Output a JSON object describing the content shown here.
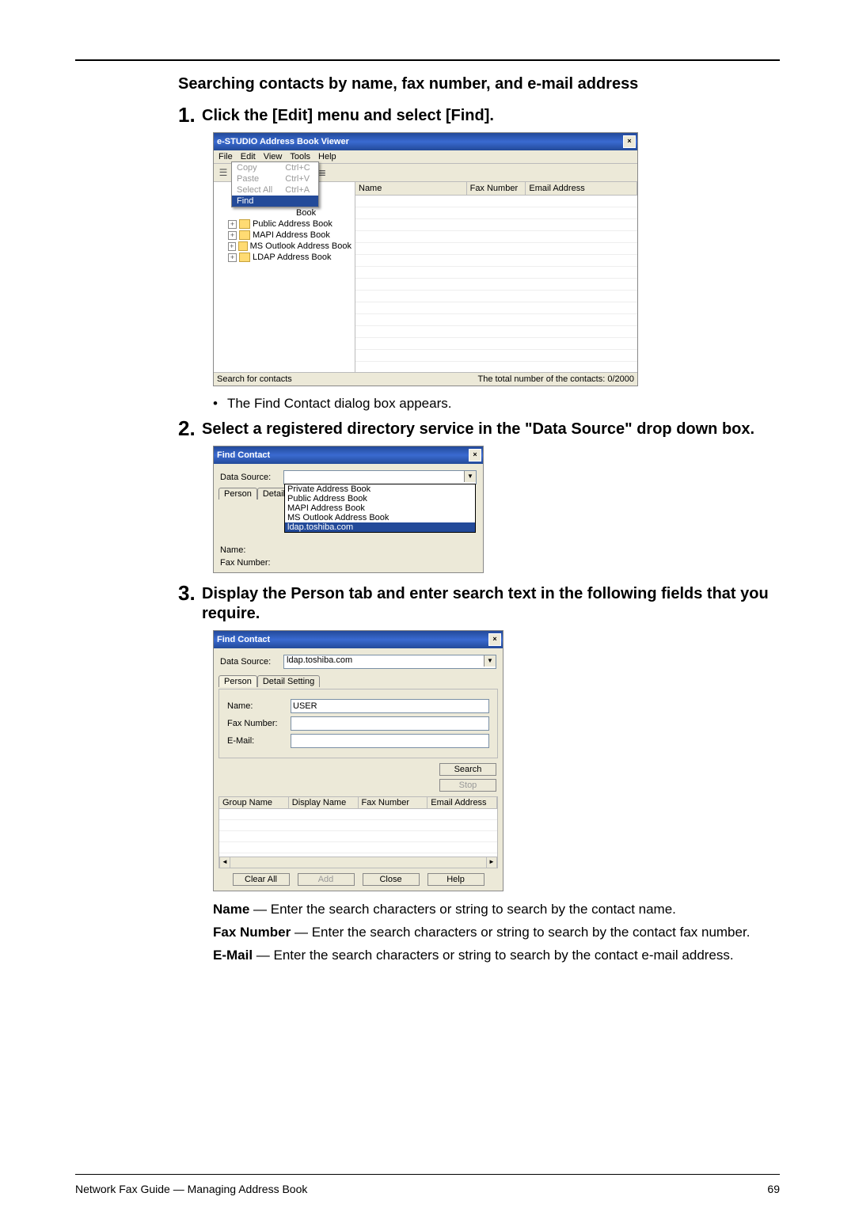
{
  "section_title": "Searching contacts by name, fax number, and e-mail address",
  "steps": {
    "s1_num": "1.",
    "s1_text": "Click the [Edit] menu and select [Find].",
    "s1_bullet": "The Find Contact dialog box appears.",
    "s2_num": "2.",
    "s2_text": "Select a registered directory service in the \"Data Source\" drop down box.",
    "s3_num": "3.",
    "s3_text": "Display the Person tab and enter search text in the following fields that you require."
  },
  "defs": {
    "name_label": "Name",
    "name_text": " — Enter the search characters or string to search by the contact name.",
    "fax_label": "Fax Number",
    "fax_text": " — Enter the search characters or string to search by the contact fax number.",
    "email_label": "E-Mail",
    "email_text": " — Enter the search characters or string to search by the contact e-mail address."
  },
  "footer": {
    "left": "Network Fax Guide — Managing Address Book",
    "right": "69"
  },
  "win1": {
    "title": "e-STUDIO Address Book Viewer",
    "menus": {
      "file": "File",
      "edit": "Edit",
      "view": "View",
      "tools": "Tools",
      "help": "Help"
    },
    "edit_menu": {
      "copy": "Copy",
      "copy_sc": "Ctrl+C",
      "paste": "Paste",
      "paste_sc": "Ctrl+V",
      "select_all": "Select All",
      "select_all_sc": "Ctrl+A",
      "find": "Find"
    },
    "tree": {
      "root": "Address Book",
      "n1part1": "ook",
      "n1part2": "Book",
      "n2": "Public Address Book",
      "n3": "MAPI Address Book",
      "n4": "MS Outlook Address Book",
      "n5": "LDAP Address Book"
    },
    "cols": {
      "name": "Name",
      "fax": "Fax Number",
      "email": "Email Address"
    },
    "status_left": "Search for contacts",
    "status_right": "The total number of the contacts: 0/2000"
  },
  "win2": {
    "title": "Find Contact",
    "data_source": "Data Source:",
    "tabs": {
      "person": "Person",
      "detail": "Detail Setting"
    },
    "name": "Name:",
    "fax": "Fax Number:",
    "options": {
      "o1": "Private Address Book",
      "o2": "Public Address Book",
      "o3": "MAPI Address Book",
      "o4": "MS Outlook Address Book",
      "o5": "ldap.toshiba.com"
    }
  },
  "win3": {
    "title": "Find Contact",
    "data_source": "Data Source:",
    "data_source_val": "ldap.toshiba.com",
    "tabs": {
      "person": "Person",
      "detail": "Detail Setting"
    },
    "name": "Name:",
    "name_val": "USER",
    "fax": "Fax Number:",
    "email": "E-Mail:",
    "search": "Search",
    "stop": "Stop",
    "cols": {
      "group": "Group Name",
      "display": "Display Name",
      "fax": "Fax Number",
      "email": "Email Address"
    },
    "buttons": {
      "clear": "Clear All",
      "add": "Add",
      "close": "Close",
      "help": "Help"
    }
  }
}
